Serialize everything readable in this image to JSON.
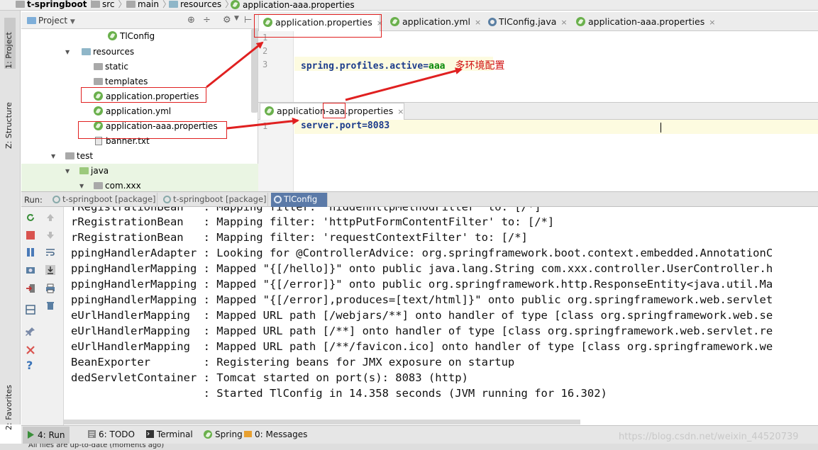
{
  "breadcrumb": {
    "items": [
      "t-springboot",
      "src",
      "main",
      "resources",
      "application-aaa.properties"
    ]
  },
  "tool_strip": {
    "project": "1: Project",
    "structure": "Z: Structure",
    "favorites": "2: Favorites"
  },
  "project_panel": {
    "title": "Project",
    "run_config": "TlConfig",
    "tree": [
      {
        "label": "resources",
        "type": "folder-res",
        "indent": 1,
        "expanded": true
      },
      {
        "label": "static",
        "type": "folder",
        "indent": 2
      },
      {
        "label": "templates",
        "type": "folder",
        "indent": 2
      },
      {
        "label": "application.properties",
        "type": "spring",
        "indent": 2
      },
      {
        "label": "application.yml",
        "type": "spring",
        "indent": 2
      },
      {
        "label": "application-aaa.properties",
        "type": "spring",
        "indent": 2
      },
      {
        "label": "banner.txt",
        "type": "file",
        "indent": 2
      },
      {
        "label": "test",
        "type": "folder",
        "indent": 0,
        "expanded": true
      },
      {
        "label": "java",
        "type": "folder-green",
        "indent": 1,
        "expanded": true
      },
      {
        "label": "com.xxx",
        "type": "folder",
        "indent": 2
      }
    ]
  },
  "editor_tabs": [
    {
      "label": "application.properties",
      "icon": "spring-icon",
      "active": true
    },
    {
      "label": "application.yml",
      "icon": "spring-icon",
      "active": false
    },
    {
      "label": "TlConfig.java",
      "icon": "gear-icon",
      "active": false
    },
    {
      "label": "application-aaa.properties",
      "icon": "spring-icon",
      "active": false
    }
  ],
  "editor1": {
    "line_numbers": [
      "1",
      "2",
      "3"
    ],
    "line3_key": "spring.profiles.active",
    "line3_eq": "=",
    "line3_value": "aaa",
    "note": "多环境配置"
  },
  "editor2": {
    "tab_label": "application-aaa.properties",
    "line_numbers": [
      "1"
    ],
    "line1_key": "server.port",
    "line1_eq": "=",
    "line1_value": "8083"
  },
  "run_bar": {
    "label": "Run:",
    "tabs": [
      "t-springboot [package]",
      "t-springboot [package]",
      "TlConfig"
    ]
  },
  "console_lines": [
    "rRegistrationBean   : Mapping filter: 'hiddenHttpMethodFilter' to: [/*]",
    "rRegistrationBean   : Mapping filter: 'httpPutFormContentFilter' to: [/*]",
    "rRegistrationBean   : Mapping filter: 'requestContextFilter' to: [/*]",
    "ppingHandlerAdapter : Looking for @ControllerAdvice: org.springframework.boot.context.embedded.AnnotationC",
    "ppingHandlerMapping : Mapped \"{[/hello]}\" onto public java.lang.String com.xxx.controller.UserController.h",
    "ppingHandlerMapping : Mapped \"{[/error]}\" onto public org.springframework.http.ResponseEntity<java.util.Ma",
    "ppingHandlerMapping : Mapped \"{[/error],produces=[text/html]}\" onto public org.springframework.web.servlet",
    "eUrlHandlerMapping  : Mapped URL path [/webjars/**] onto handler of type [class org.springframework.web.se",
    "eUrlHandlerMapping  : Mapped URL path [/**] onto handler of type [class org.springframework.web.servlet.re",
    "eUrlHandlerMapping  : Mapped URL path [/**/favicon.ico] onto handler of type [class org.springframework.we",
    "BeanExporter        : Registering beans for JMX exposure on startup",
    "dedServletContainer : Tomcat started on port(s): 8083 (http)",
    "                    : Started TlConfig in 14.358 seconds (JVM running for 16.302)"
  ],
  "bottom_tabs": [
    {
      "label": "4: Run",
      "active": true
    },
    {
      "label": "6: TODO",
      "active": false
    },
    {
      "label": "Terminal",
      "active": false
    },
    {
      "label": "Spring",
      "active": false
    },
    {
      "label": "0: Messages",
      "active": false
    }
  ],
  "watermark": "https://blog.csdn.net/weixin_44520739",
  "status": "All files are up-to-date (moments ago)",
  "colors": {
    "annotation_red": "#e02020",
    "spring_green": "#6ab04c",
    "keyword_blue": "#1c3c8c",
    "value_green": "#0a8a0a",
    "run_tab_active": "#5b7aa8"
  }
}
